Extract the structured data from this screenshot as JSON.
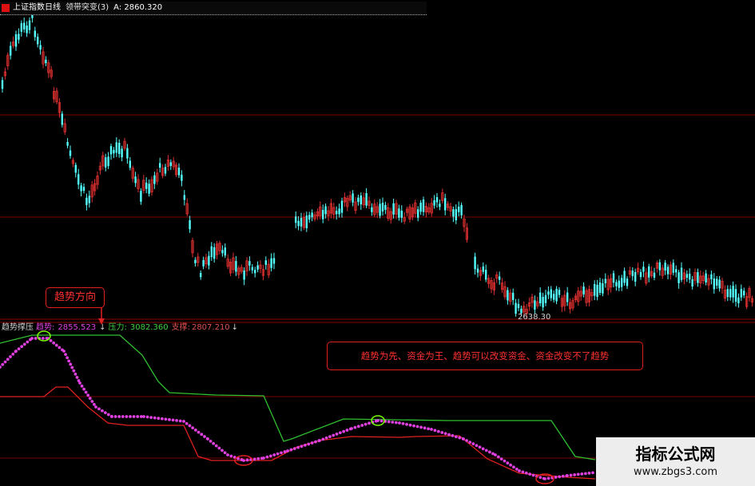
{
  "header": {
    "title": "上证指数日线",
    "indicator": "领带突变(3)",
    "value": "A: 2860.320"
  },
  "subchart": {
    "name": "趋势撑压",
    "trend_label": "趋势:",
    "trend_value": "2855.523",
    "trend_arrow": "↓",
    "pressure_label": "压力:",
    "pressure_value": "3082.360",
    "support_label": "支撑:",
    "support_value": "2807.210",
    "support_arrow": "↓"
  },
  "price_low_label": "2638.30",
  "annotations": {
    "direction": "趋势方向",
    "note": "趋势为先、资金为王、趋势可以改变资金、资金改变不了趋势"
  },
  "watermark": {
    "line1": "指标公式网",
    "line2": "www.zbgs3.com"
  },
  "colors": {
    "up": "#e03030",
    "down": "#54ffff",
    "trend": "#e040e0",
    "pressure": "#30c030",
    "support": "#e02020",
    "grid": "#8b0000"
  }
}
